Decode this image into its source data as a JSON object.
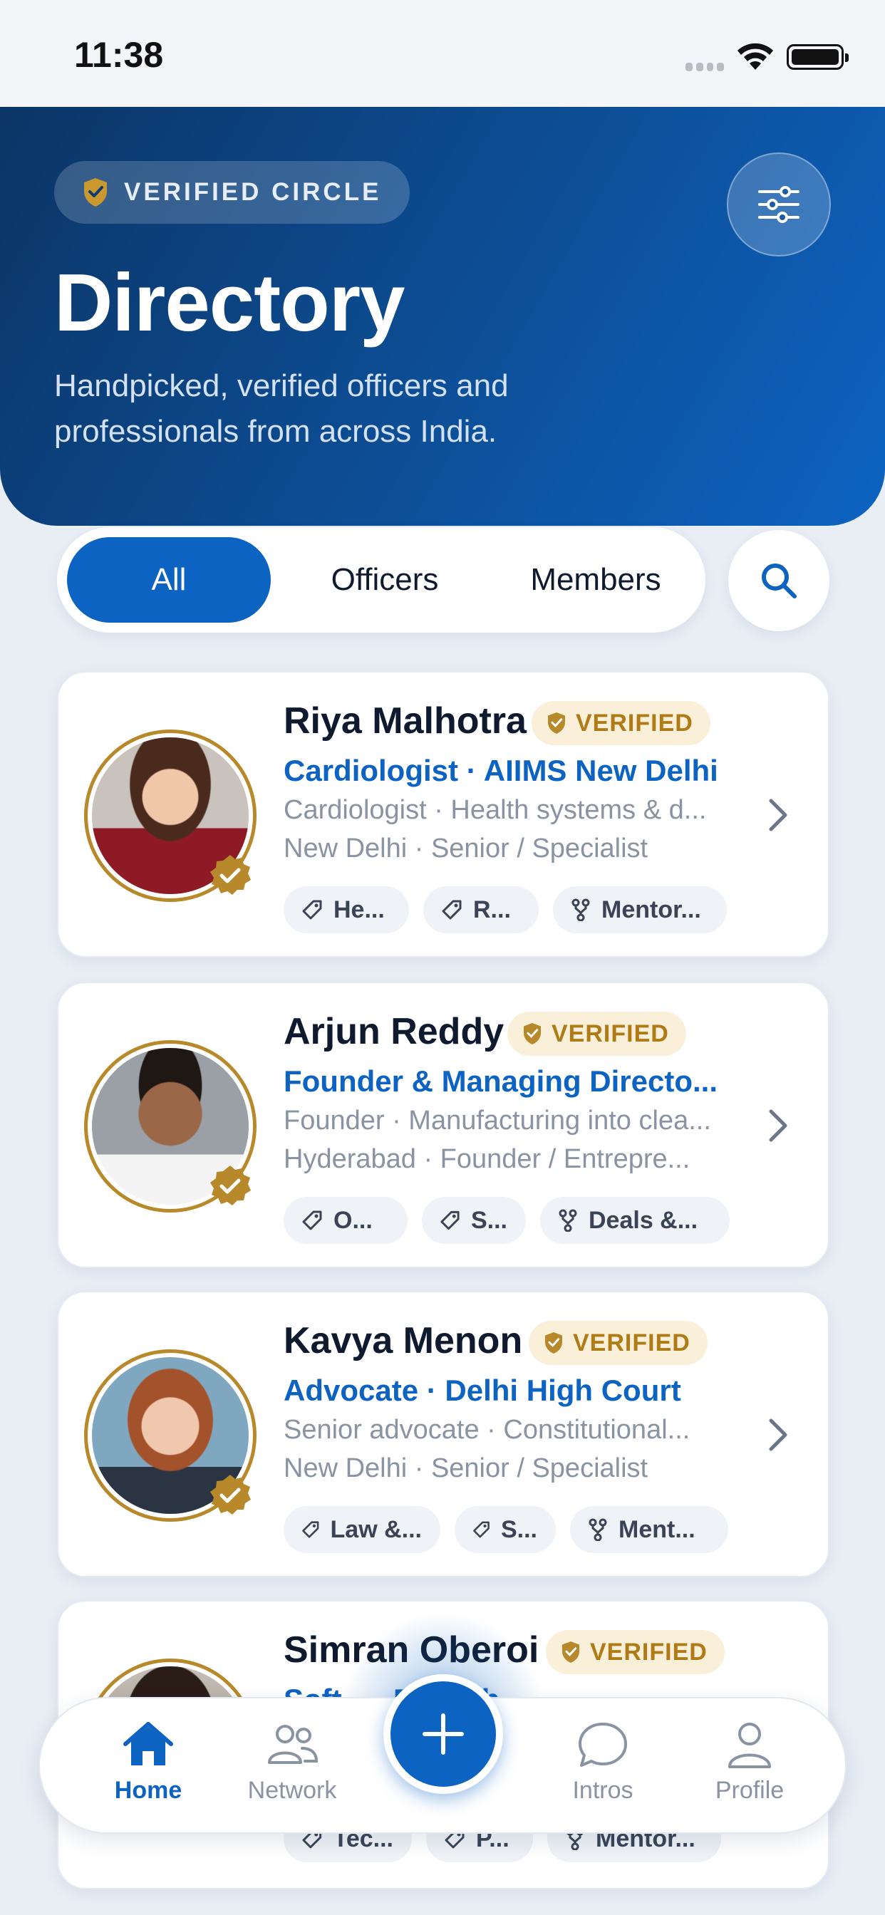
{
  "status_bar": {
    "time": "11:38"
  },
  "header": {
    "badge": "VERIFIED CIRCLE",
    "title": "Directory",
    "subtitle": "Handpicked, verified officers and professionals from across India."
  },
  "segments": [
    {
      "label": "All",
      "active": true
    },
    {
      "label": "Officers",
      "active": false
    },
    {
      "label": "Members",
      "active": false
    }
  ],
  "verified_label": "VERIFIED",
  "people": [
    {
      "name": "Riya Malhotra",
      "role": "Cardiologist · AIIMS New Delhi",
      "description": "Cardiologist · Health systems & d...",
      "location": "New Delhi · Senior / Specialist",
      "chips": [
        "He...",
        "R...",
        "Mentor..."
      ]
    },
    {
      "name": "Arjun Reddy",
      "role": "Founder & Managing Directo...",
      "description": "Founder · Manufacturing into clea...",
      "location": "Hyderabad · Founder / Entrepre...",
      "chips": [
        "O...",
        "S...",
        "Deals &..."
      ]
    },
    {
      "name": "Kavya Menon",
      "role": "Advocate · Delhi High Court",
      "description": "Senior advocate · Constitutional...",
      "location": "New Delhi · Senior / Specialist",
      "chips": [
        "Law &...",
        "S...",
        "Ment..."
      ]
    },
    {
      "name": "Simran Oberoi",
      "role": "Soft... · Fintech",
      "description": "",
      "location": "",
      "chips": [
        "Tec...",
        "P...",
        "Mentor..."
      ]
    }
  ],
  "tabbar": {
    "home": "Home",
    "network": "Network",
    "intros": "Intros",
    "profile": "Profile"
  },
  "colors": {
    "primary": "#0d63c2",
    "header_dark": "#0b3566",
    "gold": "#b8892a",
    "muted": "#8a93a2"
  }
}
